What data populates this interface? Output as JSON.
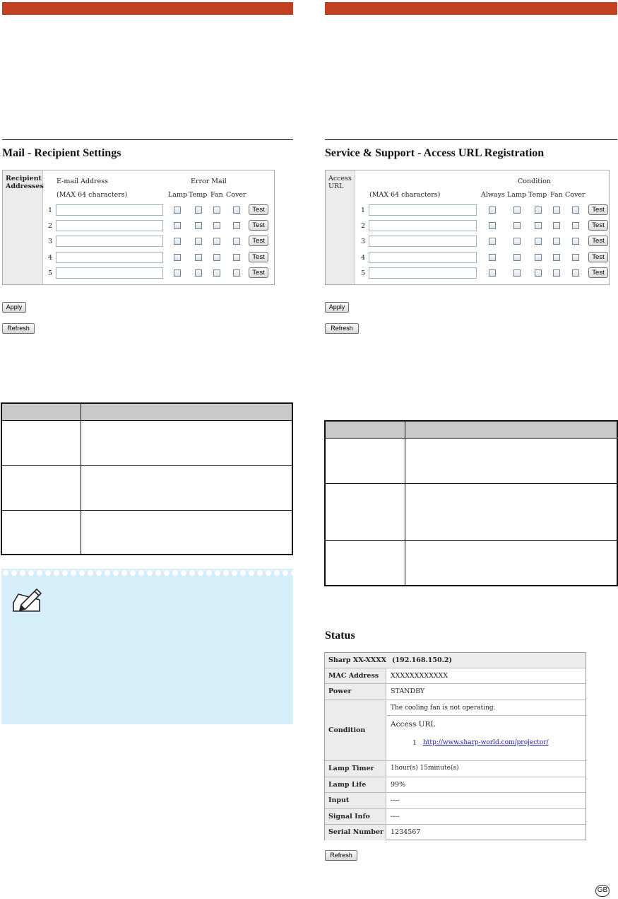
{
  "mail": {
    "title": "Mail - Recipient Settings",
    "side_label": "Recipient Addresses",
    "col_address": "E-mail Address",
    "col_max": "(MAX 64 characters)",
    "col_error": "Error Mail",
    "checkbox_headers": [
      "Lamp",
      "Temp",
      "Fan",
      "Cover"
    ],
    "rows": [
      "1",
      "2",
      "3",
      "4",
      "5"
    ],
    "test_label": "Test",
    "apply_label": "Apply",
    "refresh_label": "Refresh"
  },
  "service": {
    "title": "Service & Support - Access URL Registration",
    "side_label": "Access URL",
    "col_max": "(MAX 64 characters)",
    "col_condition": "Condition",
    "checkbox_headers": [
      "Always",
      "Lamp",
      "Temp",
      "Fan",
      "Cover"
    ],
    "rows": [
      "1",
      "2",
      "3",
      "4",
      "5"
    ],
    "test_label": "Test",
    "apply_label": "Apply",
    "refresh_label": "Refresh"
  },
  "status": {
    "title": "Status",
    "model": "Sharp XX-XXXX",
    "ip": "(192.168.150.2)",
    "rows": [
      {
        "label": "MAC Address",
        "value": "XXXXXXXXXXXX"
      },
      {
        "label": "Power",
        "value": "STANDBY"
      },
      {
        "label": "Lamp Timer",
        "value": "1hour(s) 15minute(s)"
      },
      {
        "label": "Lamp Life",
        "value": "99%"
      },
      {
        "label": "Input",
        "value": "----"
      },
      {
        "label": "Signal Info",
        "value": "----"
      },
      {
        "label": "Serial Number",
        "value": "1234567"
      }
    ],
    "condition_label": "Condition",
    "condition_text": "The cooling fan is not operating.",
    "access_url_label": "Access URL",
    "access_url_index": "1",
    "access_url_link": "http://www.sharp-world.com/projector/",
    "refresh_label": "Refresh"
  },
  "colors": {
    "header_bar": "#c0401f",
    "note_bg": "#d7effb",
    "link": "#1a1aa0"
  },
  "icons": {
    "note": "pencil-icon"
  },
  "page_badge": "GB"
}
